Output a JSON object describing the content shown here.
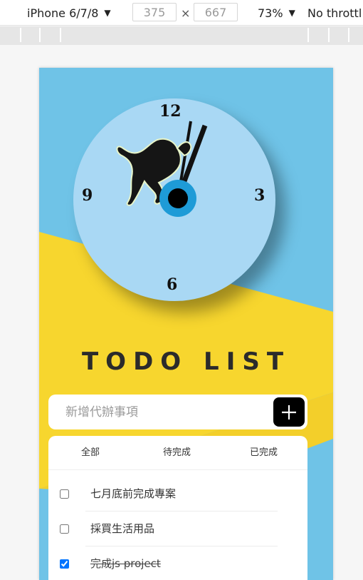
{
  "devtools": {
    "device": "iPhone 6/7/8",
    "width": "375",
    "height": "667",
    "zoom": "73%",
    "throttle": "No throttl",
    "caret": "▼",
    "times": "×"
  },
  "clock": {
    "numbers": {
      "n12": "12",
      "n3": "3",
      "n6": "6",
      "n9": "9"
    }
  },
  "app": {
    "title": "TODO LIST",
    "input_placeholder": "新增代辦事項",
    "tabs": [
      "全部",
      "待完成",
      "已完成"
    ],
    "todos": [
      {
        "text": "七月底前完成專案",
        "done": false
      },
      {
        "text": "採買生活用品",
        "done": false
      },
      {
        "text": "完成js project",
        "done": true
      }
    ]
  },
  "colors": {
    "sky": "#6fc3e7",
    "yellow": "#f7d62e",
    "clock_face": "#a9d8f4",
    "center_ring": "#1e9bd7",
    "accent": "#000000"
  }
}
